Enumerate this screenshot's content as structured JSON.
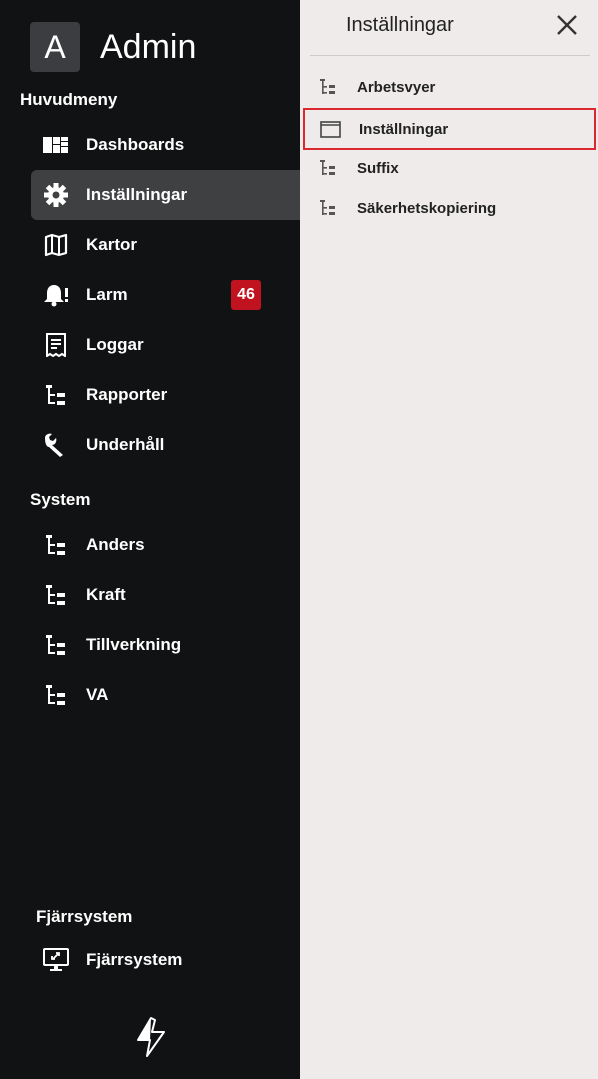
{
  "sidebar": {
    "avatar_letter": "A",
    "app_name": "Admin",
    "main_section": "Huvudmeny",
    "main_items": [
      {
        "label": "Dashboards",
        "icon": "dashboard-icon"
      },
      {
        "label": "Inställningar",
        "icon": "gear-icon",
        "active": true
      },
      {
        "label": "Kartor",
        "icon": "map-icon"
      },
      {
        "label": "Larm",
        "icon": "bell-alert-icon",
        "badge": "46"
      },
      {
        "label": "Loggar",
        "icon": "receipt-icon"
      },
      {
        "label": "Rapporter",
        "icon": "tree-icon"
      },
      {
        "label": "Underhåll",
        "icon": "wrench-icon"
      }
    ],
    "system_section": "System",
    "system_items": [
      {
        "label": "Anders",
        "icon": "tree-icon"
      },
      {
        "label": "Kraft",
        "icon": "tree-icon"
      },
      {
        "label": "Tillverkning",
        "icon": "tree-icon"
      },
      {
        "label": "VA",
        "icon": "tree-icon"
      }
    ],
    "remote_section": "Fjärrsystem",
    "remote_item": {
      "label": "Fjärrsystem",
      "icon": "remote-desktop-icon"
    }
  },
  "panel": {
    "title": "Inställningar",
    "items": [
      {
        "label": "Arbetsvyer",
        "icon": "tree-icon"
      },
      {
        "label": "Inställningar",
        "icon": "window-icon",
        "highlighted": true
      },
      {
        "label": "Suffix",
        "icon": "tree-icon"
      },
      {
        "label": "Säkerhetskopiering",
        "icon": "tree-icon"
      }
    ]
  },
  "colors": {
    "sidebar_bg": "#111213",
    "active_bg": "#3f4042",
    "badge_bg": "#c1121f",
    "panel_bg": "#efebea",
    "highlight": "#d9282f"
  }
}
